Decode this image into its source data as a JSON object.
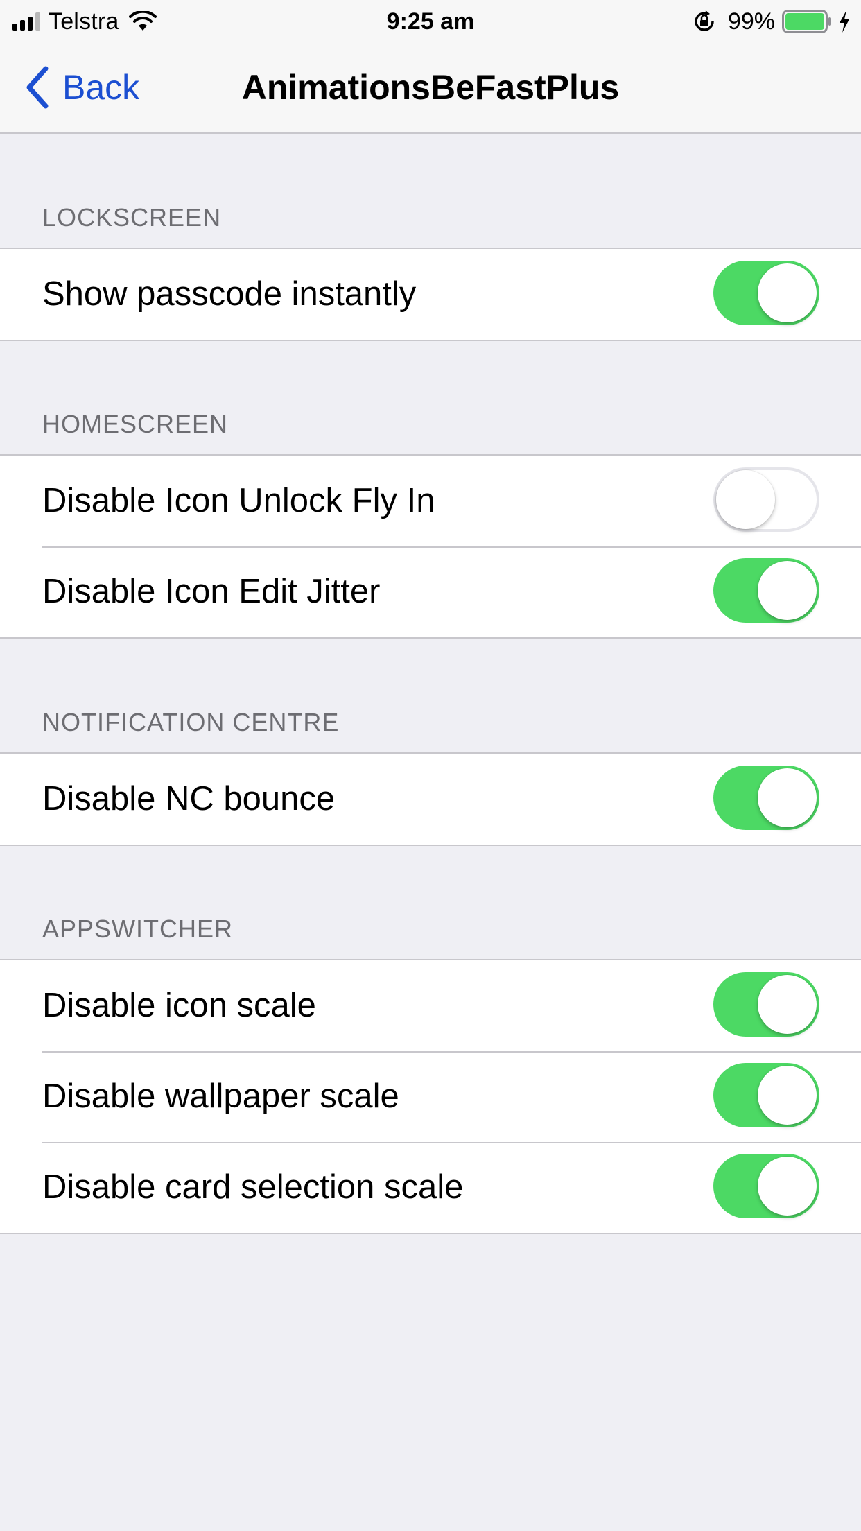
{
  "status_bar": {
    "carrier": "Telstra",
    "time": "9:25 am",
    "battery_percent": "99%",
    "battery_level": 0.99,
    "battery_color": "#4cd964",
    "icons": [
      "signal-bars-icon",
      "wifi-icon",
      "rotation-lock-icon",
      "battery-icon",
      "charging-bolt-icon"
    ]
  },
  "nav": {
    "back_label": "Back",
    "title": "AnimationsBeFastPlus",
    "accent_color": "#1c4fd1"
  },
  "sections": [
    {
      "header": "LOCKSCREEN",
      "rows": [
        {
          "label": "Show passcode instantly",
          "on": true
        }
      ]
    },
    {
      "header": "HOMESCREEN",
      "rows": [
        {
          "label": "Disable Icon Unlock Fly In",
          "on": false
        },
        {
          "label": "Disable Icon Edit Jitter",
          "on": true
        }
      ]
    },
    {
      "header": "NOTIFICATION CENTRE",
      "rows": [
        {
          "label": "Disable NC bounce",
          "on": true
        }
      ]
    },
    {
      "header": "APPSWITCHER",
      "rows": [
        {
          "label": "Disable icon scale",
          "on": true
        },
        {
          "label": "Disable wallpaper scale",
          "on": true
        },
        {
          "label": "Disable card selection scale",
          "on": true
        }
      ]
    }
  ],
  "colors": {
    "toggle_on": "#4cd964",
    "background": "#efeff4"
  }
}
